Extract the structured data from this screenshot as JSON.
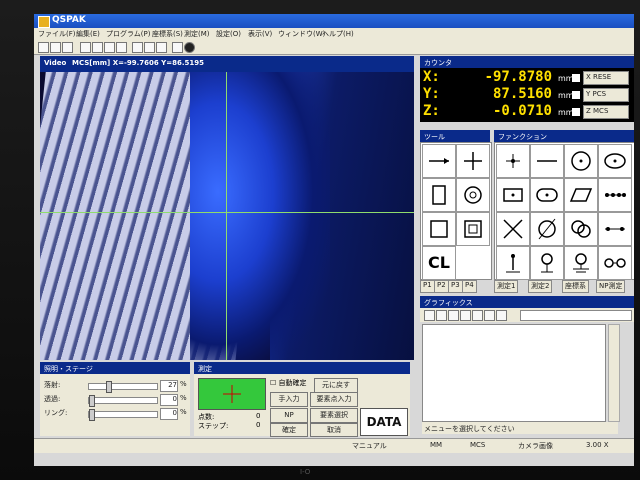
{
  "app": {
    "title": "QSPAK"
  },
  "menu": [
    "ファイル(F)",
    "編集(E)",
    "プログラム(P)",
    "座標系(S)",
    "測定(M)",
    "設定(O)",
    "表示(V)",
    "ウィンドウ(W)",
    "ヘルプ(H)"
  ],
  "video": {
    "label": "Video",
    "coords": "MCS[mm] X=-99.7606 Y=86.5195"
  },
  "counter": {
    "title": "カウンタ",
    "axes": [
      {
        "axis": "X:",
        "value": "-97.8780",
        "unit": "mm",
        "button": "X RESE"
      },
      {
        "axis": "Y:",
        "value": "87.5160",
        "unit": "mm",
        "button": "Y PCS"
      },
      {
        "axis": "Z:",
        "value": "-0.0710",
        "unit": "mm",
        "button": "Z MCS"
      }
    ]
  },
  "tools": {
    "title": "ツール",
    "cl_label": "CL",
    "tool_icons": [
      "arrow-tool-icon",
      "cross-tool-icon",
      "box-tool-icon",
      "circle-tool-icon",
      "square-tool-icon",
      "square2-tool-icon",
      "cl-tool-icon"
    ],
    "tabs": [
      "P1",
      "P2",
      "P3",
      "P4"
    ]
  },
  "functions": {
    "title": "ファンクション",
    "icons": [
      "point-func-icon",
      "line-func-icon",
      "circle-func-icon",
      "ellipse-func-icon",
      "rect-func-icon",
      "slot-func-icon",
      "parallelogram-func-icon",
      "dots-func-icon",
      "x-intersect-func-icon",
      "circle-line-func-icon",
      "double-circle-func-icon",
      "dots-line-func-icon",
      "pin-func-icon",
      "pin-circle-func-icon",
      "ground-func-icon",
      "chain-func-icon"
    ],
    "tabs": [
      "測定1",
      "測定2",
      "座標系",
      "NP測定"
    ]
  },
  "graphics": {
    "title": "グラフィックス",
    "status": "メニューを選択してください"
  },
  "lighting": {
    "title": "照明・ステージ",
    "rows": [
      {
        "label": "落射:",
        "value": "27",
        "unit": "%",
        "level": 0.27
      },
      {
        "label": "透過:",
        "value": "0",
        "unit": "%",
        "level": 0.0
      },
      {
        "label": "リング:",
        "value": "0",
        "unit": "%",
        "level": 0.0
      }
    ]
  },
  "measure": {
    "title": "測定",
    "auto_confirm": "自動確定",
    "manual_input": "手入力",
    "point_input": "要素点入力",
    "undo": "元に戻す",
    "np": "NP",
    "select": "要素選択",
    "data": "DATA",
    "points_label": "点数:",
    "points_value": "0",
    "step_label": "ステップ:",
    "step_value": "0",
    "confirm": "確定",
    "cancel": "取消"
  },
  "status": {
    "mode": "マニュアル",
    "unit": "MM",
    "coord": "MCS",
    "camera": "カメラ画像",
    "zoom": "3.00 X"
  },
  "monitor": {
    "brand": "I-O"
  },
  "colors": {
    "title_bar": "#1a4fc0",
    "counter_text": "#ffe000",
    "crosshair": "#8fdc6c",
    "target": "#34c83c"
  }
}
